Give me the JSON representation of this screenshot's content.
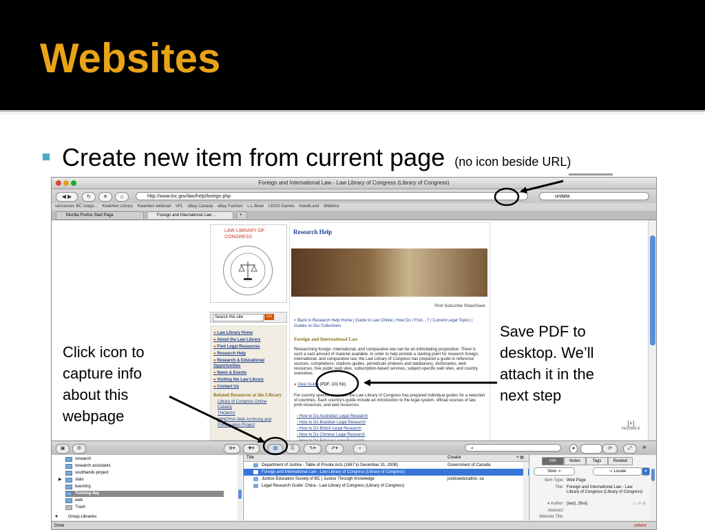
{
  "slide": {
    "title": "Websites",
    "bullet": "Create new item from current page",
    "bullet_note": "(no icon beside URL)",
    "left_caption": "Click icon to capture info about this webpage",
    "right_caption": "Save PDF to desktop. We’ll attach it in the next step",
    "colors": {
      "title": "#e8a317",
      "bullet": "#4bacc6",
      "header_bg": "#000000"
    }
  },
  "browser": {
    "window_title": "Foreign and International Law - Law Library of Congress (Library of Congress)",
    "url": "http://www.loc.gov/law/help/foreign.php",
    "search_value": "undata",
    "bookmarks": [
      "vancouver, BC craigs...",
      "Kwantlen Library",
      "Kwantlen webmail",
      "VPL",
      "eBay Canada",
      "eBay Fashion",
      "L.L.Bean",
      "LEGO Games",
      "HandiLand",
      "Webkinz"
    ],
    "tabs": [
      "Mozilla Firefox Start Page",
      "Foreign and International Law ..."
    ],
    "status": "Done"
  },
  "loc_page": {
    "logo_text": "LAW LIBRARY OF CONGRESS",
    "seal_text": "THE LAW LIBRARY OF CONGRESS",
    "search_placeholder": "Search this site",
    "search_go": "GO",
    "nav_links": [
      "Law Library Home",
      "About the Law Library",
      "Find Legal Resources",
      "Research Help",
      "Research & Educational Opportunities",
      "News & Events",
      "Visiting the Law Library",
      "Contact Us"
    ],
    "related_title": "Related Resources at the Library",
    "related_links": [
      "Library of Congress Online Catalog",
      "THOMAS",
      "MINERVA Web Archiving and Preservation Project"
    ],
    "heading": "Research Help",
    "print_links": "Print  Subscribe  Share/Save",
    "crumbs": "< Back to Research Help Home | Guide to Law Online | How Do I Find... ? | Current Legal Topics | Guides to Our Collections",
    "section_title": "Foreign and International Law",
    "section_body": "Researching foreign, international, and comparative law can be an intimidating proposition. There is such a vast amount of material available. In order to help provide a starting point for research foreign, international, and comparative law, the Law Library of Congress has prepared a guide to reference sources, compilations, citations guides, periodicals (indexes and databases), dictionaries, web resources, free public web sites, subscription-based services, subject-specific web sites, and country overviews.",
    "view_guide": "View Guide",
    "pdf_size": "(PDF, 101 Kb)",
    "country_text": "For country specific research, the Law Library of Congress has prepared individual guides for a selection of countries. Each country's guide include an introduction to the legal system, official sources of law, print resources, and web resources.",
    "guides": [
      "How to Do Australian Legal Research",
      "How to Do Brazilian Legal Research",
      "How to Do British Legal Research",
      "How to Do Chinese Legal Research",
      "How to Do Eritrean Legal Research"
    ],
    "feedback": "FEEDBACK"
  },
  "zotero": {
    "collections": [
      "research",
      "research assistants",
      "southlands project",
      "stats",
      "teaching",
      "Training day",
      "web",
      "Trash",
      "Group Libraries"
    ],
    "selected_collection": "Training day",
    "columns": {
      "title": "Title",
      "creator": "Creator"
    },
    "items": [
      {
        "title": "Department of Justice - Table of Private Acts (1867 to December 31, 2008)",
        "creator": "Government of Canada"
      },
      {
        "title": "Foreign and International Law - Law Library of Congress (Library of Congress)",
        "creator": ""
      },
      {
        "title": "Justice Education Society of BC | Justice Through Knowledge",
        "creator": "justiceeducation. ca"
      },
      {
        "title": "Legal Research Guide: China - Law Library of Congress (Library of Congress)",
        "creator": ""
      }
    ],
    "info_tabs": [
      "Info",
      "Notes",
      "Tags",
      "Related"
    ],
    "view_btn": "View",
    "locate_btn": "Locate",
    "fields": {
      "item_type_label": "Item Type:",
      "item_type": "Web Page",
      "title_label": "Title:",
      "title": "Foreign and International Law - Law Library of Congress (Library of Congress)",
      "author_label": "Author:",
      "author_last": "(last)",
      "author_first": "(first)",
      "abstract_label": "Abstract:",
      "website_title_label": "Website Title:"
    },
    "logo": "zotero"
  }
}
